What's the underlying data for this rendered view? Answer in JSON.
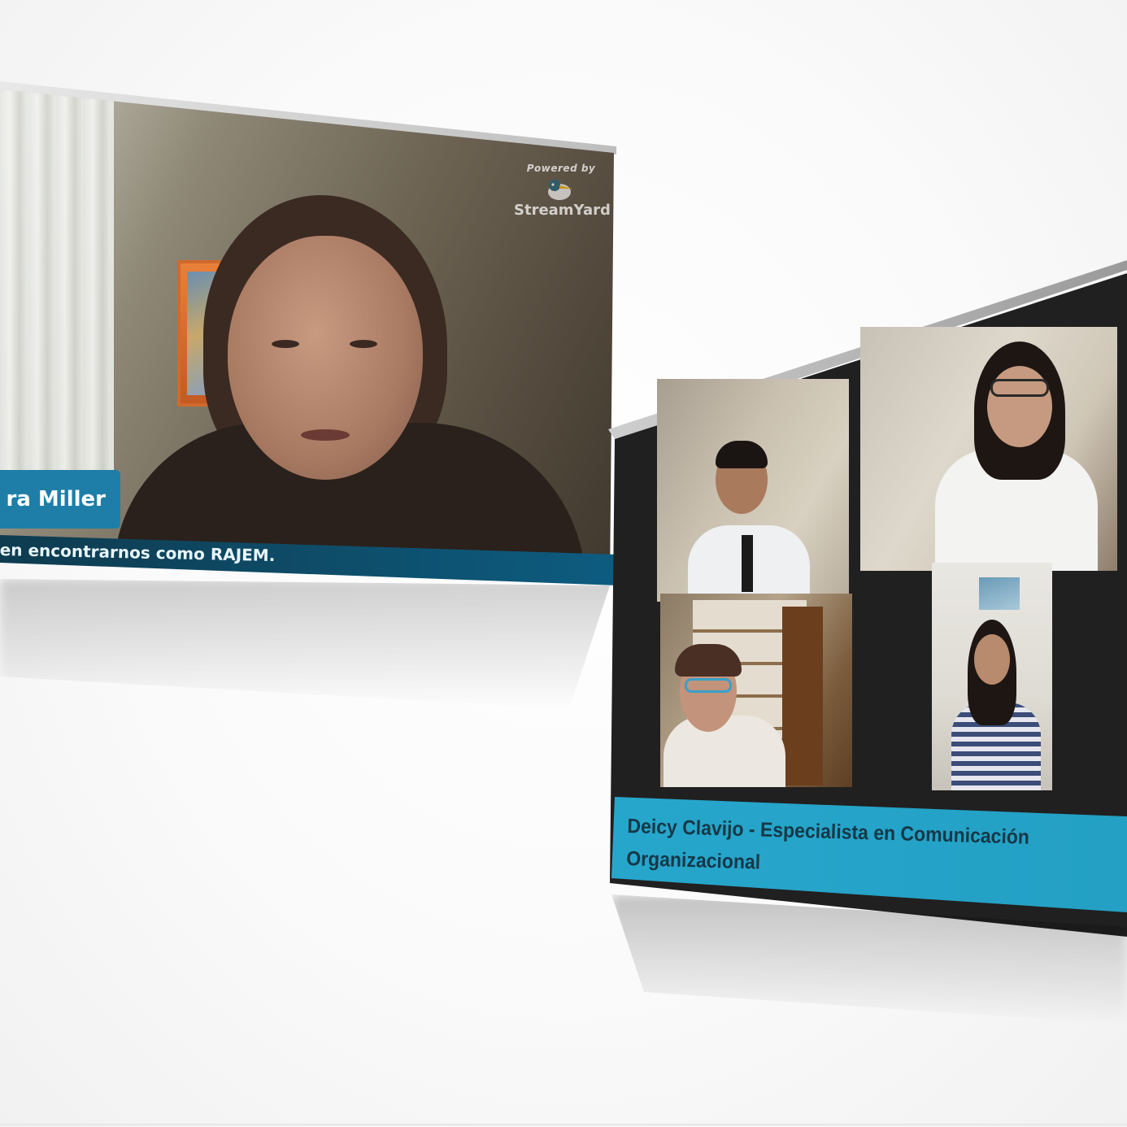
{
  "left_panel": {
    "name_tag": "ra Miller",
    "caption": "en encontrarnos como RAJEM.",
    "branding": {
      "powered_by": "Powered by",
      "name": "StreamYard"
    }
  },
  "right_panel": {
    "caption_line1": "Deicy Clavijo - Especialista en Comunicación",
    "caption_line2": "Organizacional"
  },
  "colors": {
    "accent": "#1e7ea8",
    "caption_dark": "#0d5c80",
    "caption_light": "#27a6cc"
  }
}
